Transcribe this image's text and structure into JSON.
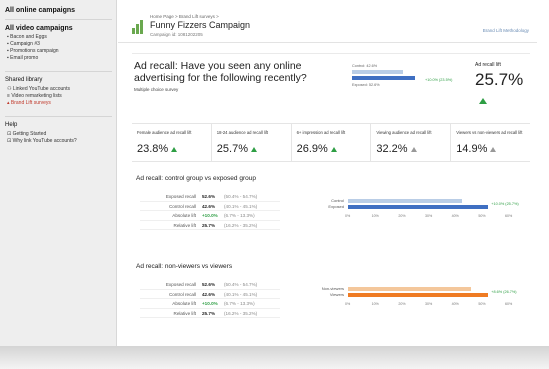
{
  "sidebar": {
    "top_items": [
      {
        "label": "All online campaigns"
      },
      {
        "label": "All video campaigns"
      }
    ],
    "campaigns": [
      "Bacon and Eggs",
      "Campaign #3",
      "Promotions campaign",
      "Email promo"
    ],
    "shared_library_label": "Shared library",
    "library_items": [
      "Linked YouTube accounts",
      "Video remarketing lists",
      "Brand Lift surveys"
    ],
    "help_label": "Help",
    "help_items": [
      "Getting Started",
      "Why link YouTube accounts?"
    ]
  },
  "header": {
    "breadcrumb": "Home Page > Brand Lift surveys >",
    "campaign_title": "Funny Fizzers Campaign",
    "campaign_id": "Campaign id: 1081202205",
    "brand": "Brand Lift Methodology"
  },
  "summary": {
    "question": "Ad recall: Have you seen any online advertising for the following recently?",
    "survey_type": "Multiple choice survey",
    "mini_chart": {
      "control_label": "Control: 42.6%",
      "exposed_label": "Exposed: 52.6%",
      "lift_label": "+10.0% (23.5%)",
      "control_value": 42.6,
      "exposed_value": 52.6
    },
    "headline_label": "Ad recall lift",
    "headline_value": "25.7%"
  },
  "segments": [
    {
      "label": "Female audience ad recall lift",
      "value": "23.8%",
      "trend": "up"
    },
    {
      "label": "18-24 audience ad recall lift",
      "value": "25.7%",
      "trend": "up"
    },
    {
      "label": "6+ impression ad recall lift",
      "value": "26.9%",
      "trend": "up"
    },
    {
      "label": "Viewing audience ad recall lift",
      "value": "32.2%",
      "trend": "neutral"
    },
    {
      "label": "Viewers vs non-viewers ad recall lift",
      "value": "14.9%",
      "trend": "neutral"
    }
  ],
  "control_vs_exposed": {
    "title": "Ad recall: control group vs exposed group",
    "rows": [
      {
        "label": "Exposed recall",
        "value": "52.6%",
        "ci": "(50.4% - 54.7%)",
        "green": false
      },
      {
        "label": "Control recall",
        "value": "42.6%",
        "ci": "(40.1% - 45.1%)",
        "green": false
      },
      {
        "label": "Absolute lift",
        "value": "+10.0%",
        "ci": "(6.7% - 13.3%)",
        "green": true
      },
      {
        "label": "Relative lift",
        "value": "25.7%",
        "ci": "(16.2% - 35.2%)",
        "green": false
      }
    ],
    "chart": {
      "label_a": "Control",
      "label_b": "Exposed",
      "value_a": 42.6,
      "value_b": 52.6,
      "lift": "+10.0% (25.7%)",
      "ticks": [
        "0%",
        "10%",
        "20%",
        "30%",
        "40%",
        "50%",
        "60%"
      ]
    }
  },
  "viewers": {
    "title": "Ad recall: non-viewers vs viewers",
    "rows": [
      {
        "label": "Exposed recall",
        "value": "52.6%",
        "ci": "(50.4% - 54.7%)",
        "green": false
      },
      {
        "label": "Control recall",
        "value": "42.6%",
        "ci": "(40.1% - 45.1%)",
        "green": false
      },
      {
        "label": "Absolute lift",
        "value": "+10.0%",
        "ci": "(6.7% - 13.3%)",
        "green": true
      },
      {
        "label": "Relative lift",
        "value": "25.7%",
        "ci": "(16.2% - 35.2%)",
        "green": false
      }
    ],
    "chart": {
      "label_a": "Non-viewers",
      "label_b": "Viewers",
      "value_a": 46.0,
      "value_b": 52.6,
      "lift": "+8.6% (26.7%)",
      "ticks": [
        "0%",
        "10%",
        "20%",
        "30%",
        "40%",
        "50%",
        "60%"
      ]
    }
  },
  "colors": {
    "blue_light": "#b9cde6",
    "blue": "#3f6fc2",
    "orange_light": "#f4c79b",
    "orange": "#ef7b23",
    "green": "#2e9e44",
    "logo_green": "#6aa84f"
  }
}
